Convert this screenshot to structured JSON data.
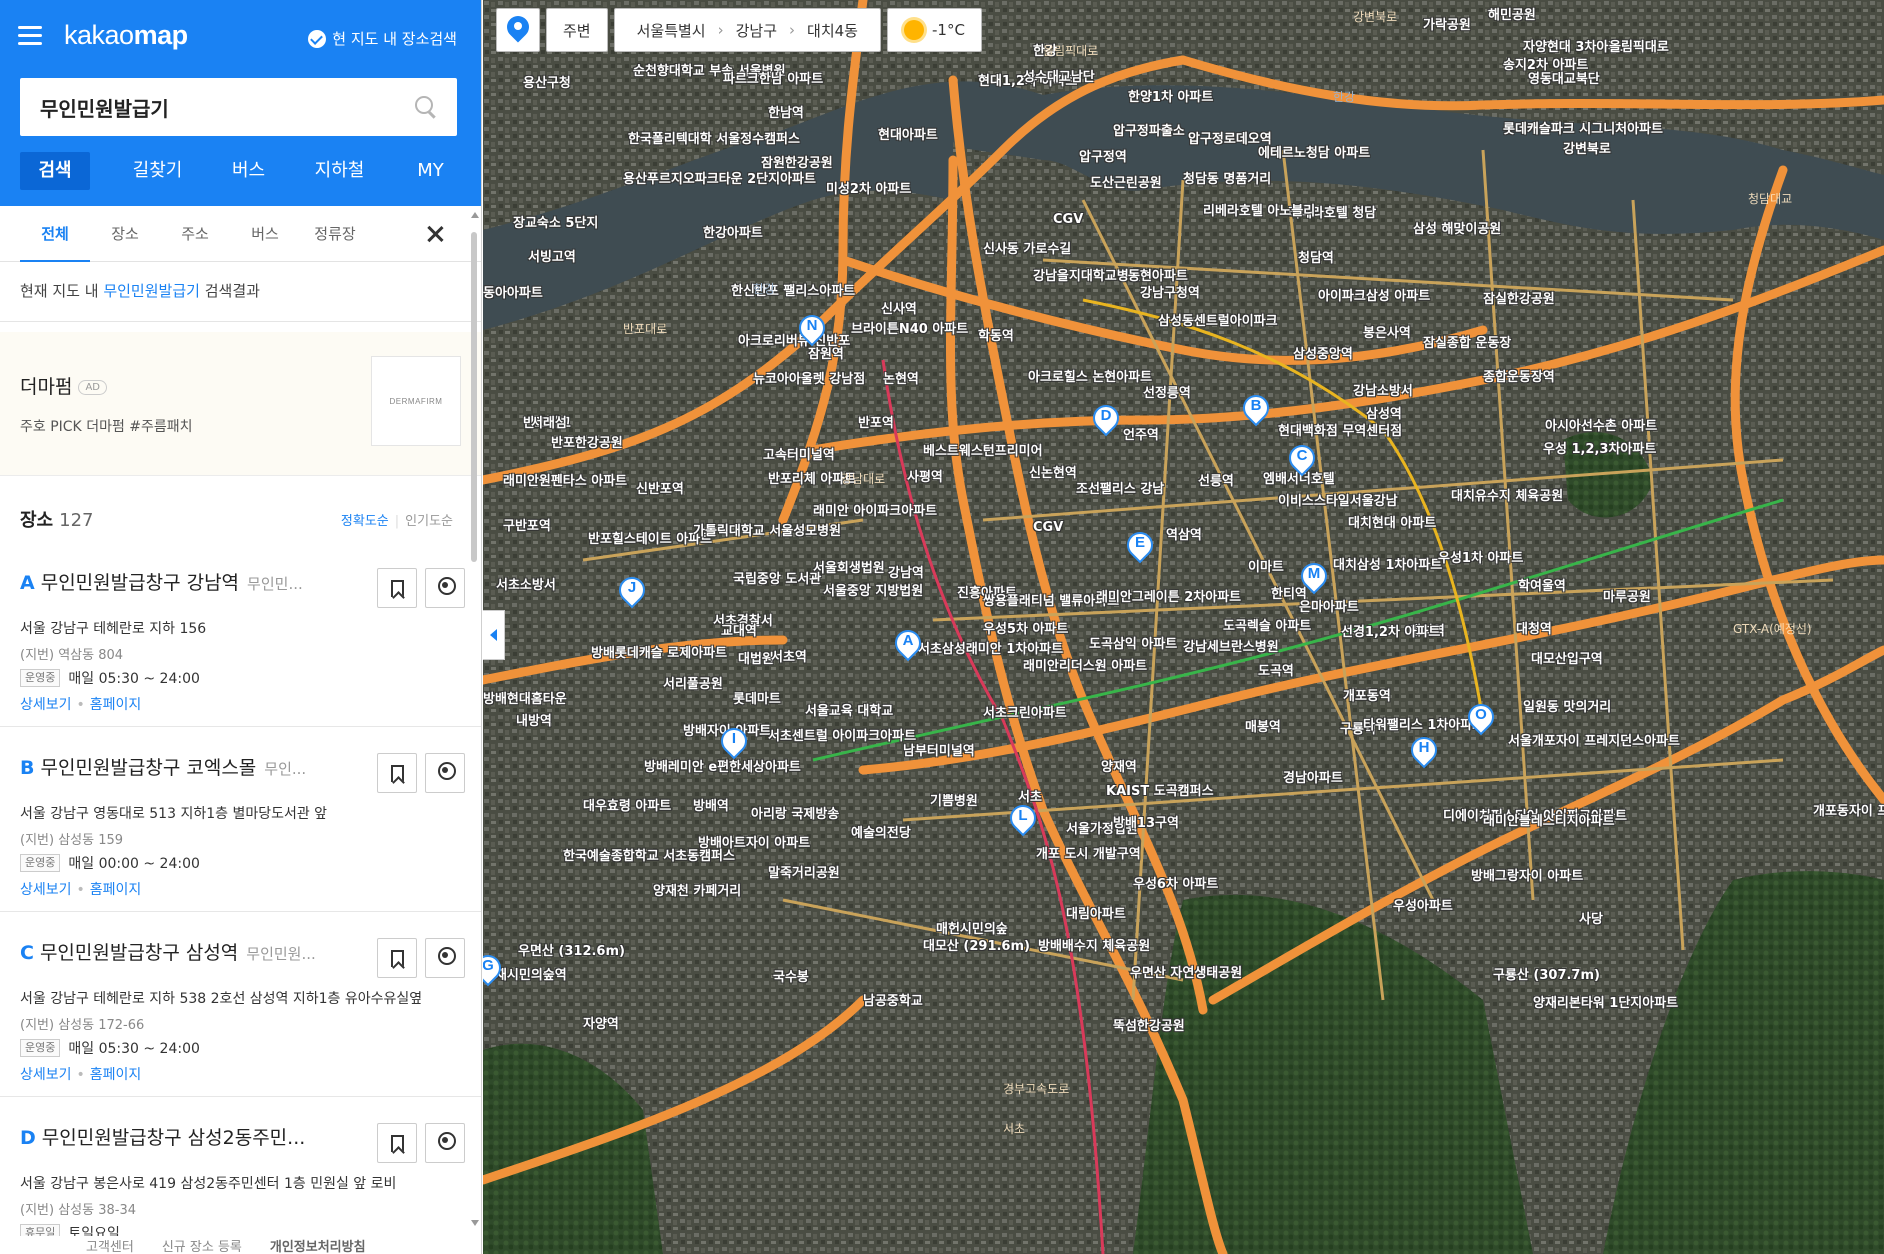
{
  "sidebar": {
    "logo_prefix": "kakao",
    "logo_suffix": "map",
    "map_search_label": "현 지도 내 장소검색",
    "search_value": "무인민원발급기",
    "main_tabs": [
      "검색",
      "길찾기",
      "버스",
      "지하철",
      "MY"
    ],
    "sub_tabs": [
      "전체",
      "장소",
      "주소",
      "버스",
      "정류장"
    ],
    "result_prefix": "현재 지도 내",
    "result_keyword": "무인민원발급기",
    "result_suffix": "검색결과",
    "ad": {
      "title": "더마펌",
      "badge": "AD",
      "desc": "주호 PICK 더마펌 #주름패치",
      "thumb": "DERMAFIRM"
    },
    "places_title": "장소",
    "places_count": "127",
    "sort_accuracy": "정확도순",
    "sort_popular": "인기도순",
    "items": [
      {
        "letter": "A",
        "name": "무인민원발급창구 강남역",
        "cat": "무인민...",
        "addr": "서울 강남구 테헤란로 지하 156",
        "jibun": "(지번) 역삼동 804",
        "status": "운영중",
        "hours": "매일 05:30 ~ 24:00",
        "detail": "상세보기",
        "homepage": "홈페이지"
      },
      {
        "letter": "B",
        "name": "무인민원발급창구 코엑스몰",
        "cat": "무인...",
        "addr": "서울 강남구 영동대로 513 지하1층 별마당도서관 앞",
        "jibun": "(지번) 삼성동 159",
        "status": "운영중",
        "hours": "매일 00:00 ~ 24:00",
        "detail": "상세보기",
        "homepage": "홈페이지"
      },
      {
        "letter": "C",
        "name": "무인민원발급창구 삼성역",
        "cat": "무인민원...",
        "addr": "서울 강남구 테헤란로 지하 538 2호선 삼성역 지하1층 유아수유실옆",
        "jibun": "(지번) 삼성동 172-66",
        "status": "운영중",
        "hours": "매일 05:30 ~ 24:00",
        "detail": "상세보기",
        "homepage": "홈페이지"
      },
      {
        "letter": "D",
        "name": "무인민원발급창구 삼성2동주민...",
        "cat": "",
        "addr": "서울 강남구 봉은사로 419 삼성2동주민센터 1층 민원실 앞 로비",
        "jibun": "(지번) 삼성동 38-34",
        "status": "휴무일",
        "hours": "토일요일",
        "detail": "상세보기",
        "homepage": "홈페이지"
      }
    ],
    "footer": [
      "고객센터",
      "신규 장소 등록",
      "개인정보처리방침"
    ]
  },
  "map": {
    "nearby": "주변",
    "crumbs": [
      "서울특별시",
      "강남구",
      "대치4동"
    ],
    "temp": "-1°C",
    "markers": [
      "A",
      "B",
      "C",
      "D",
      "E",
      "G",
      "H",
      "I",
      "J",
      "L",
      "M",
      "N",
      "O"
    ],
    "labels": [
      "용산구청",
      "순천향대학교 부속 서울병원",
      "파르크한남 아파트",
      "한남역",
      "한국폴리텍대학 서울정수캠퍼스",
      "용산푸르지오파크타운 2단지아파트",
      "장교숙소 5단지",
      "서빙고역",
      "동아아파트",
      "한강아파트",
      "잠원한강공원",
      "미성2차 아파트",
      "현대아파트",
      "현대1,2차 아파트",
      "성수대교남단",
      "압구정역",
      "압구정파출소",
      "한양1차 아파트",
      "압구정로데오역",
      "에테르노청담 아파트",
      "청담동 명품거리",
      "리베라호텔 청담",
      "리베라호텔 아노블리",
      "도산근린공원",
      "CGV",
      "신사동 가로수길",
      "강남을지대학교병원",
      "동현아파트",
      "강남구청역",
      "청담역",
      "아이파크삼성 아파트",
      "봉은사역",
      "잠실종합 운동장",
      "종합운동장역",
      "삼성 해맞이공원",
      "잠실한강공원",
      "신사역",
      "잠원역",
      "아크로리버뷰 신반포",
      "한신반포 팰리스아파트",
      "브라이튼N40 아파트",
      "학동역",
      "삼성동센트럴아이파크",
      "삼성중앙역",
      "뉴코아아울렛 강남점",
      "논현역",
      "아크로힐스 논현아파트",
      "선정릉역",
      "강남소방서",
      "삼성역",
      "현대백화점 무역센터점",
      "아시아선수촌 아파트",
      "우성 1,2,3차아파트",
      "반포대교",
      "반포역",
      "반포한강공원",
      "서래섬",
      "고속터미널역",
      "베스트웨스턴프리미어",
      "언주역",
      "선릉역",
      "엠배서더호텔",
      "이비스스타일서울강남",
      "대치유수지 체육공원",
      "래미안원펜타스 아파트",
      "신반포역",
      "반포리체 아파트",
      "사평역",
      "신논현역",
      "조선팰리스 강남",
      "대치현대 아파트",
      "구반포역",
      "반포힐스테이트 아파트",
      "가톨릭대학교 서울성모병원",
      "래미안 아이파크아파트",
      "CGV",
      "역삼역",
      "이마트",
      "국립중앙 도서관",
      "서울회생법원",
      "서울중앙 지방법원",
      "진흥아파트",
      "강남역",
      "대치삼성 1차아파트",
      "우성1차 아파트",
      "학여울역",
      "마루공원",
      "서초소방서",
      "서초경찰서",
      "교대역",
      "쌍용플래티넘 밸류아파트",
      "래미안그레이튼 2차아파트",
      "한티역",
      "은마아파트",
      "대치역",
      "대청역",
      "대모산입구역",
      "방배롯데캐슬 로제아파트",
      "대법원",
      "서초역",
      "서초삼성래미안 1차아파트",
      "우성5차 아파트",
      "도곡삼익 아파트",
      "강남세브란스병원",
      "도곡렉슬 아파트",
      "선경1,2차 아파트",
      "서리풀공원",
      "롯데마트",
      "방배현대홈타운",
      "래미안리더스원 아파트",
      "도곡역",
      "개포동역",
      "내방역",
      "서울교육 대학교",
      "서초크린아파트",
      "매봉역",
      "구룡역",
      "타워팰리스 1차아파트",
      "방배자이 아파트",
      "서초센트럴 아이파크아파트",
      "남부터미널역",
      "일원동 맛의거리",
      "서울개포자이 프레지던스아파트",
      "방배레미안 e편한세상아파트",
      "양재역",
      "경남아파트",
      "기쁨병원",
      "서초",
      "KAIST 도곡캠퍼스",
      "대우효령 아파트",
      "방배역",
      "아리랑 국제방송",
      "예술의전당",
      "디에이치퍼스티어 아이파크아파트",
      "래미안블레스티지아파트",
      "방배아트자이 아파트",
      "서울가정법원",
      "방배13구역",
      "한국예술종합학교 서초동캠퍼스",
      "말죽거리공원",
      "개포 도시 개발구역",
      "방배그랑자이 아파트",
      "양재천 카페거리",
      "우성6차 아파트",
      "우성아파트",
      "대림아파트",
      "매헌시민의숲",
      "대모산 (291.6m)",
      "방배배수지 체육공원",
      "사당",
      "우면산 (312.6m)",
      "양재시민의숲역",
      "국수봉",
      "우면산 자연생태공원",
      "구룡산 (307.7m)",
      "남공중학교",
      "양재리본타워 1단지아파트",
      "자양역",
      "뚝섬한강공원",
      "영동대교북단",
      "롯데캐슬파크 시그니처아파트",
      "송지2차 아파트",
      "해민공원",
      "자양현대 3차아파트",
      "올림픽대로",
      "강변북로",
      "한강",
      "가락공원",
      "개포동자이 프레지던스"
    ],
    "roads": [
      "올림픽대로",
      "강변북로",
      "반포대로",
      "강남대로",
      "청담대교",
      "GTX-A(예정선)",
      "경부고속도로",
      "서초"
    ],
    "water": [
      "한강",
      "한강"
    ]
  }
}
